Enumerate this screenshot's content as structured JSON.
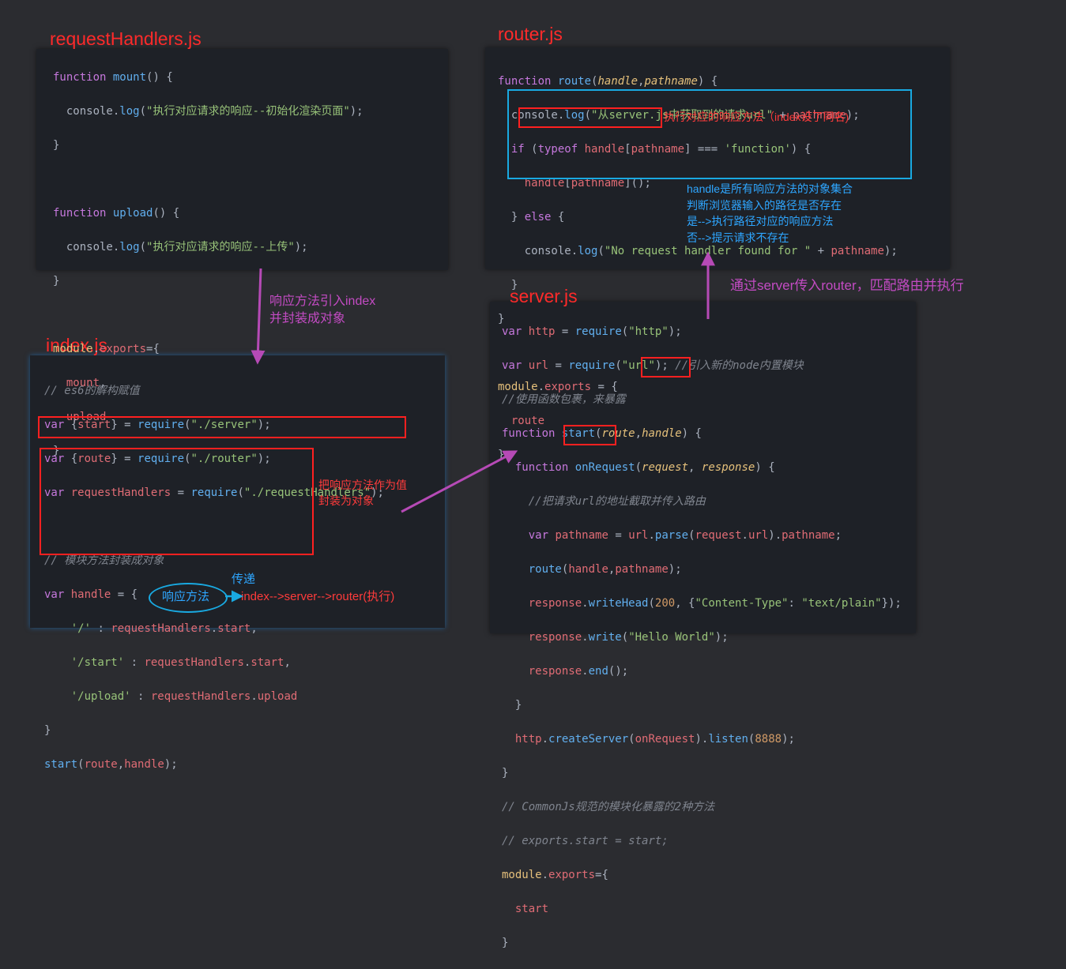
{
  "colors": {
    "background": "#2b2c30",
    "panel": "#1e2127",
    "title": "#ff2a2a",
    "annotation_red": "#ff3b3b",
    "annotation_purple": "#c34bc3",
    "annotation_blue": "#2ea6ff"
  },
  "files": {
    "requestHandlers": {
      "title": "requestHandlers.js",
      "lines": [
        "function mount() {",
        "  console.log(\"执行对应请求的响应--初始化渲染页面\");",
        "}",
        "",
        "function upload() {",
        "  console.log(\"执行对应请求的响应--上传\");",
        "}",
        "",
        "module.exports={",
        "  mount,",
        "  upload",
        "}"
      ]
    },
    "router": {
      "title": "router.js",
      "lines": [
        "function route(handle,pathname) {",
        "  console.log(\"从server.js中获取到的请求url\" + pathname);",
        "  if (typeof handle[pathname] === 'function') {",
        "    handle[pathname]();",
        "  } else {",
        "    console.log(\"No request handler found for \" + pathname);",
        "  }",
        "}",
        "",
        "module.exports = {",
        "  route",
        "};"
      ]
    },
    "index": {
      "title": "index.js",
      "lines": [
        "// es6的解构赋值",
        "var {start} = require(\"./server\");",
        "var {route} = require(\"./router\");",
        "var requestHandlers = require(\"./requestHandlers\");",
        "",
        "// 模块方法封装成对象",
        "var handle = {",
        "    '/' : requestHandlers.start,",
        "    '/start' : requestHandlers.start,",
        "    '/upload' : requestHandlers.upload",
        "}",
        "start(route,handle);"
      ]
    },
    "server": {
      "title": "server.js",
      "lines": [
        "var http = require(\"http\");",
        "var url = require(\"url\"); //引入新的node内置模块",
        "//使用函数包裹，来暴露",
        "function start(route,handle) {",
        "  function onRequest(request, response) {",
        "    //把请求url的地址截取并传入路由",
        "    var pathname = url.parse(request.url).pathname;",
        "    route(handle,pathname);",
        "    response.writeHead(200, {\"Content-Type\": \"text/plain\"});",
        "    response.write(\"Hello World\");",
        "    response.end();",
        "  }",
        "  http.createServer(onRequest).listen(8888);",
        "}",
        "// CommonJs规范的模块化暴露的2种方法",
        "// exports.start = start;",
        "module.exports={",
        "  start",
        "}"
      ]
    }
  },
  "annotations": {
    "import_line1": "响应方法引入index",
    "import_line2": "并封装成对象",
    "router_exec": "执行对应的响应方法（index设了同名)",
    "router_note": [
      "handle是所有响应方法的对象集合",
      "判断浏览器输入的路径是否存在",
      "是-->执行路径对应的响应方法",
      "否-->提示请求不存在"
    ],
    "server_to_router": "通过server传入router，匹配路由并执行",
    "wrap_line1": "把响应方法作为值",
    "wrap_line2": "封装为对象",
    "pass_label": "传递",
    "ellipse_label": "响应方法",
    "flow_text": "index-->server-->router(执行)"
  }
}
